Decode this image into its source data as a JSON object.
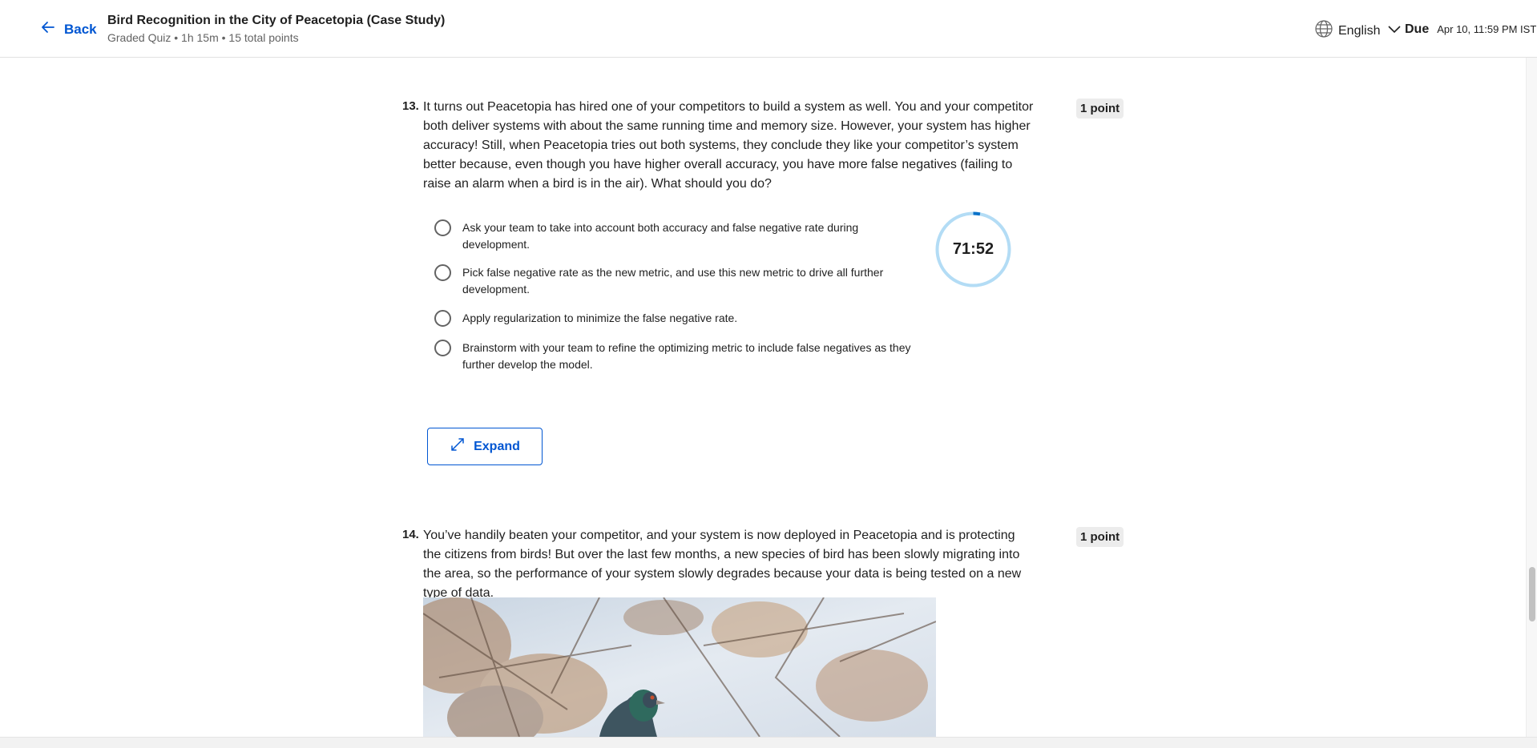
{
  "header": {
    "back_label": "Back",
    "title": "Bird Recognition in the City of Peacetopia (Case Study)",
    "meta": "Graded Quiz • 1h 15m • 15 total points",
    "language": "English",
    "due_label": "Due",
    "due_date": "Apr 10, 11:59 PM IST"
  },
  "questions": [
    {
      "number": "13.",
      "points": "1 point",
      "text": "It turns out Peacetopia has hired one of your competitors to build a system as well. You and your competitor both deliver systems with about the same running time and memory size. However, your system has higher accuracy! Still, when Peacetopia tries out both systems, they conclude they like your competitor’s system better because, even though you have higher overall accuracy, you have more false negatives (failing to raise an alarm when a bird is in the air). What should you do?",
      "options": [
        "Ask your team to take into account both accuracy and false negative rate during development.",
        "Pick false negative rate as the new metric, and use this new metric to drive all further development.",
        "Apply regularization to minimize the false negative rate.",
        "Brainstorm with your team to refine the optimizing metric to include false negatives as they further develop the model."
      ],
      "expand_label": "Expand"
    },
    {
      "number": "14.",
      "points": "1 point",
      "text": "You’ve handily beaten your competitor, and your system is now deployed in Peacetopia and is protecting the citizens from birds! But over the last few months, a new species of bird has been slowly migrating into the area, so the performance of your system slowly degrades because your data is being tested on a new type of data."
    }
  ],
  "timer": {
    "display": "71:52",
    "elapsed_fraction": 0.03,
    "ring_color": "#b3dcf5",
    "progress_color": "#0a72c9"
  },
  "colors": {
    "accent": "#0056d2",
    "badge_bg": "#ececec"
  },
  "icons": {
    "back": "arrow-left-icon",
    "language": "globe-icon",
    "dropdown": "chevron-down-icon",
    "expand": "expand-arrows-icon"
  }
}
